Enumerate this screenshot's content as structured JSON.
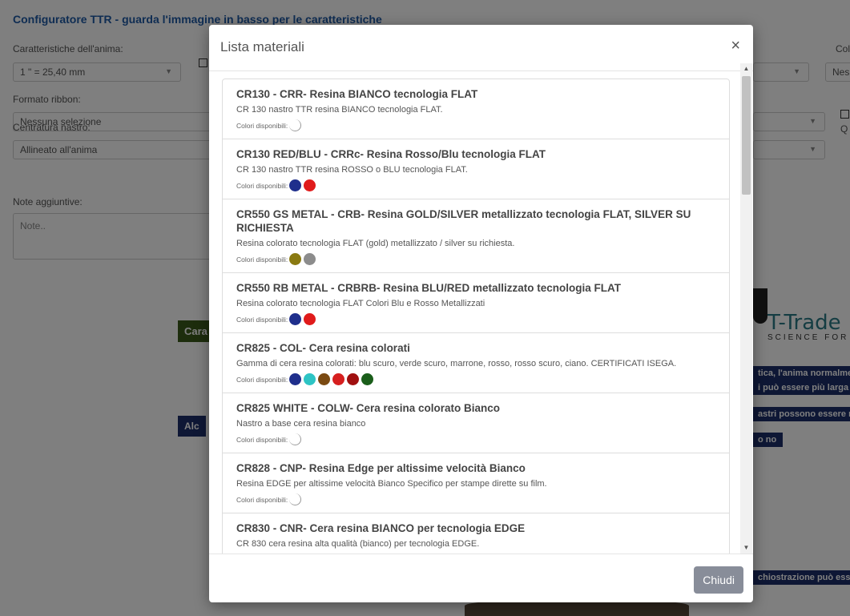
{
  "background": {
    "title": "Configuratore TTR - guarda l'immagine in basso per le caratteristiche",
    "labels": {
      "anima": "Caratteristiche dell'anima:",
      "formato": "Formato ribbon:",
      "centratura": "Centratura nastro:",
      "note": "Note aggiuntive:",
      "colore": "Color",
      "qu": "Q"
    },
    "fields": {
      "anima_value": "1 \" = 25,40 mm",
      "formato_value": "Nessuna selezione",
      "centratura_value": "Allineato all'anima",
      "note_placeholder": "Note..",
      "colore_value": "Nes"
    },
    "buttons": {
      "green": "Cara",
      "navy": "Alc"
    },
    "strips": [
      "tica, l'anima normalmente",
      "i può essere più larga del",
      "astri possono essere neri",
      "o no",
      "chiostrazione può essere"
    ],
    "logo": {
      "name": "T-Trade",
      "sub": "SCIENCE FOR"
    }
  },
  "modal": {
    "title": "Lista materiali",
    "close_symbol": "×",
    "colors_label": "Colori disponibili:",
    "items": [
      {
        "title": "CR130 - CRR- Resina BIANCO tecnologia FLAT",
        "desc": "CR 130 nastro TTR resina BIANCO tecnologia FLAT.",
        "colors": [
          "#ffffff"
        ]
      },
      {
        "title": "CR130 RED/BLU - CRRc- Resina Rosso/Blu tecnologia FLAT",
        "desc": "CR 130 nastro TTR resina ROSSO o BLU tecnologia FLAT.",
        "colors": [
          "#1f2f8c",
          "#e01b1b"
        ]
      },
      {
        "title": "CR550 GS METAL - CRB- Resina GOLD/SILVER metallizzato tecnologia FLAT, SILVER SU RICHIESTA",
        "desc": "Resina colorato tecnologia FLAT (gold) metallizzato / silver su richiesta.",
        "colors": [
          "#8a7a12",
          "#8c8c8c"
        ]
      },
      {
        "title": "CR550 RB METAL - CRBRB- Resina BLU/RED metallizzato tecnologia FLAT",
        "desc": "Resina colorato tecnologia FLAT Colori Blu e Rosso Metallizzati",
        "colors": [
          "#1f2f8c",
          "#e01b1b"
        ]
      },
      {
        "title": "CR825 - COL- Cera resina colorati",
        "desc": "Gamma di cera resina colorati: blu scuro, verde scuro, marrone, rosso, rosso scuro, ciano. CERTIFICATI ISEGA.",
        "colors": [
          "#1f2f8c",
          "#2ec4c4",
          "#7a4a12",
          "#d61f1f",
          "#a01010",
          "#1a5e1a"
        ]
      },
      {
        "title": "CR825 WHITE - COLW- Cera resina colorato Bianco",
        "desc": "Nastro a base cera resina bianco",
        "colors": [
          "#ffffff"
        ]
      },
      {
        "title": "CR828 - CNP- Resina Edge per altissime velocità Bianco",
        "desc": "Resina EDGE per altissime velocità Bianco Specifico per stampe dirette su film.",
        "colors": [
          "#ffffff"
        ]
      },
      {
        "title": "CR830 - CNR- Cera resina BIANCO per tecnologia EDGE",
        "desc": "CR 830 cera resina alta qualità (bianco) per tecnologia EDGE.",
        "colors": []
      }
    ],
    "footer_button": "Chiudi"
  }
}
